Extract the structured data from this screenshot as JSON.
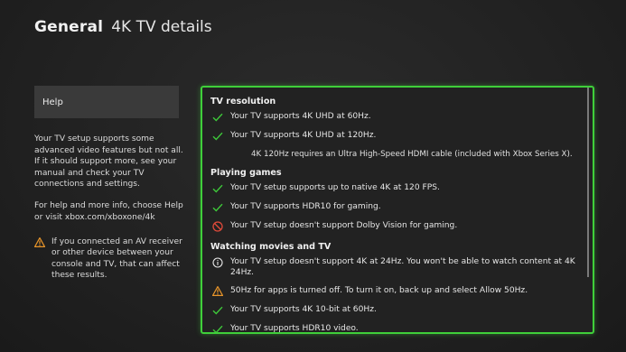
{
  "header": {
    "section": "General",
    "title": "4K TV details"
  },
  "sidebar": {
    "help_label": "Help",
    "paragraph1": "Your TV setup supports some advanced video features but not all. If it should support more, see your manual and check your TV connections and settings.",
    "paragraph2": "For help and more info, choose Help or visit xbox.com/xboxone/4k",
    "warning": "If you connected an AV receiver or other device between your console and TV, that can affect these results."
  },
  "panel": {
    "tv_resolution": {
      "heading": "TV resolution",
      "items": [
        {
          "icon": "check-icon",
          "text": "Your TV supports 4K UHD at 60Hz."
        },
        {
          "icon": "check-icon",
          "text": "Your TV supports 4K UHD at 120Hz."
        }
      ],
      "note": "4K 120Hz requires an Ultra High-Speed HDMI cable (included with Xbox Series X)."
    },
    "playing_games": {
      "heading": "Playing games",
      "items": [
        {
          "icon": "check-icon",
          "text": "Your TV setup supports up to native 4K at 120 FPS."
        },
        {
          "icon": "check-icon",
          "text": "Your TV supports HDR10 for gaming."
        },
        {
          "icon": "prohibited-icon",
          "text": "Your TV setup doesn't support Dolby Vision for gaming."
        }
      ]
    },
    "watching_movies": {
      "heading": "Watching movies and TV",
      "items": [
        {
          "icon": "info-icon",
          "text": "Your TV setup doesn't support 4K at 24Hz. You won't be able to watch content at 4K 24Hz."
        },
        {
          "icon": "warning-icon",
          "text": "50Hz for apps is turned off. To turn it on, back up and select Allow 50Hz."
        },
        {
          "icon": "check-icon",
          "text": "Your TV supports 4K 10-bit at 60Hz."
        },
        {
          "icon": "check-icon",
          "text": "Your TV supports HDR10 video."
        }
      ]
    }
  },
  "colors": {
    "accent": "#3fcf3a",
    "check": "#3ec93a",
    "prohibited": "#e04a3a",
    "warning": "#e8952a",
    "info": "#e8e8e8"
  }
}
